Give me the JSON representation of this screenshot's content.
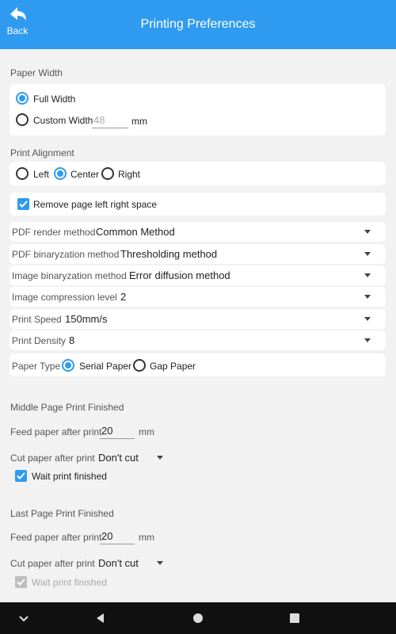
{
  "header": {
    "back_label": "Back",
    "title": "Printing Preferences"
  },
  "paper_width": {
    "section_label": "Paper Width",
    "full_width_label": "Full Width",
    "custom_width_label": "Custom Width",
    "custom_width_placeholder": "48",
    "unit": "mm"
  },
  "alignment": {
    "section_label": "Print Alignment",
    "left_label": "Left",
    "center_label": "Center",
    "right_label": "Right",
    "remove_space_label": "Remove page left right space"
  },
  "dropdowns": {
    "pdf_render": {
      "label": "PDF render method",
      "value": "Common Method"
    },
    "pdf_binarization": {
      "label": "PDF binaryzation method",
      "value": "Thresholding method"
    },
    "image_binarization": {
      "label": "Image binaryzation method",
      "value": "Error diffusion method"
    },
    "image_compression": {
      "label": "Image compression level",
      "value": "2"
    },
    "print_speed": {
      "label": "Print Speed",
      "value": "150mm/s"
    },
    "print_density": {
      "label": "Print Density",
      "value": "8"
    }
  },
  "paper_type": {
    "label": "Paper Type",
    "serial_label": "Serial Paper",
    "gap_label": "Gap Paper"
  },
  "middle_page": {
    "section_label": "Middle Page Print Finished",
    "feed_label": "Feed paper after print",
    "feed_value": "20",
    "feed_unit": "mm",
    "cut_label": "Cut paper after print",
    "cut_value": "Don't cut",
    "wait_label": "Wait print finished"
  },
  "last_page": {
    "section_label": "Last Page Print Finished",
    "feed_label": "Feed paper after print",
    "feed_value": "20",
    "feed_unit": "mm",
    "cut_label": "Cut paper after print",
    "cut_value": "Don't cut",
    "wait_label": "Wait print finished"
  },
  "colors": {
    "accent": "#2f9bf0",
    "background": "#f2f2f2",
    "navbar": "#111111"
  },
  "navbar": {
    "icons": [
      "chevron-down-icon",
      "back-triangle-icon",
      "home-circle-icon",
      "recents-square-icon"
    ]
  }
}
